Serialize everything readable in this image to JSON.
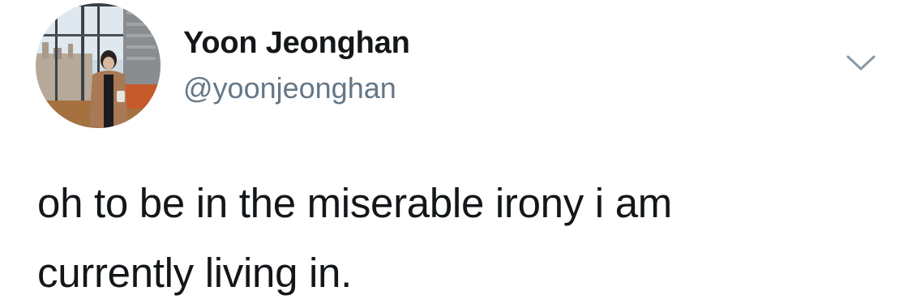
{
  "author": {
    "display_name": "Yoon Jeonghan",
    "handle": "@yoonjeonghan"
  },
  "tweet": {
    "text_lines": [
      "oh to be in the miserable irony i am",
      "currently living in."
    ]
  },
  "icons": {
    "avatar": "profile-photo",
    "menu": "chevron-down-icon"
  },
  "colors": {
    "name": "#14171a",
    "handle": "#657786",
    "caret": "#8899a6",
    "background": "#ffffff"
  }
}
